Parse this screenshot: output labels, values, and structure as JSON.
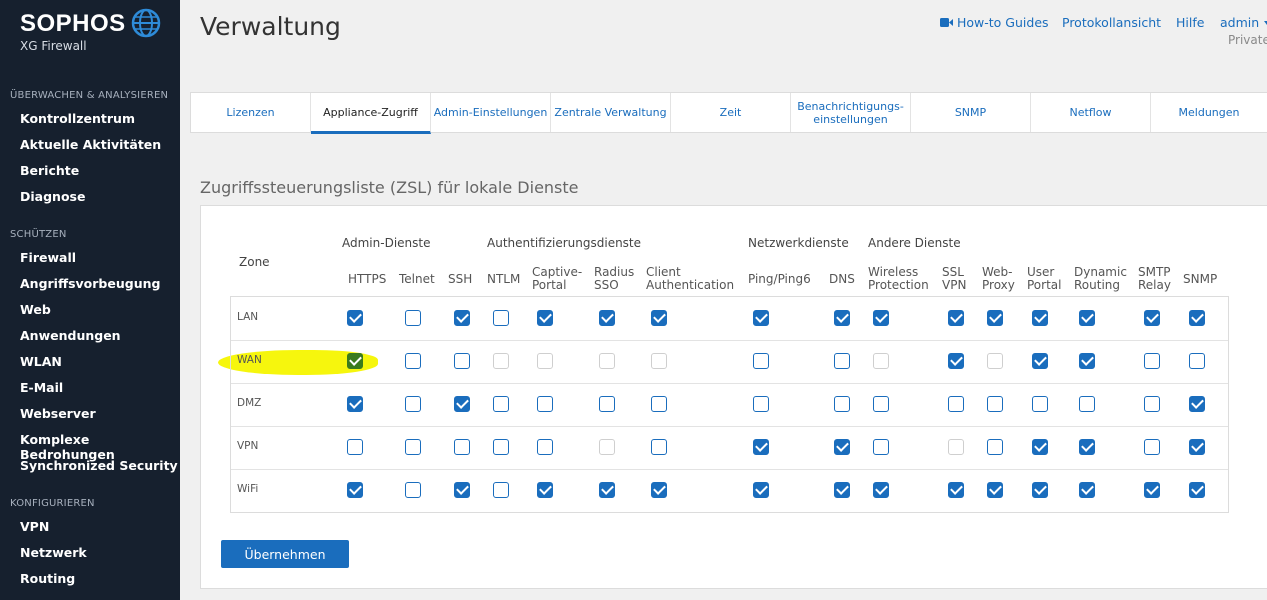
{
  "sidebar": {
    "brand": "SOPHOS",
    "product": "XG Firewall",
    "sections": [
      {
        "title": "ÜBERWACHEN & ANALYSIEREN",
        "items": [
          "Kontrollzentrum",
          "Aktuelle Aktivitäten",
          "Berichte",
          "Diagnose"
        ]
      },
      {
        "title": "SCHÜTZEN",
        "items": [
          "Firewall",
          "Angriffsvorbeugung",
          "Web",
          "Anwendungen",
          "WLAN",
          "E-Mail",
          "Webserver",
          "Komplexe Bedrohungen",
          "Synchronized Security"
        ]
      },
      {
        "title": "KONFIGURIEREN",
        "items": [
          "VPN",
          "Netzwerk",
          "Routing"
        ]
      }
    ]
  },
  "header": {
    "title": "Verwaltung",
    "links": [
      "How-to Guides",
      "Protokollansicht",
      "Hilfe",
      "admin"
    ],
    "subtitle": "Private"
  },
  "tabs": [
    "Lizenzen",
    "Appliance-Zugriff",
    "Admin-Einstellungen",
    "Zentrale Verwaltung",
    "Zeit",
    "Benachrichtigungs-\neinstellungen",
    "SNMP",
    "Netflow",
    "Meldungen"
  ],
  "active_tab": 1,
  "section_title": "Zugriffssteuerungsliste (ZSL) für lokale Dienste",
  "table": {
    "zone_header": "Zone",
    "groups": [
      "Admin-Dienste",
      "Authentifizierungsdienste",
      "Netzwerkdienste",
      "Andere Dienste"
    ],
    "columns": [
      "HTTPS",
      "Telnet",
      "SSH",
      "NTLM",
      "Captive-\nPortal",
      "Radius\nSSO",
      "Client\nAuthentication",
      "Ping/Ping6",
      "DNS",
      "Wireless\nProtection",
      "SSL\nVPN",
      "Web-\nProxy",
      "User\nPortal",
      "Dynamic\nRouting",
      "SMTP\nRelay",
      "SNMP"
    ],
    "zones": [
      "LAN",
      "WAN",
      "DMZ",
      "VPN",
      "WiFi"
    ],
    "states": [
      [
        "on",
        "off",
        "on",
        "off",
        "on",
        "on",
        "on",
        "on",
        "on",
        "on",
        "on",
        "on",
        "on",
        "on",
        "on",
        "on"
      ],
      [
        "on",
        "off",
        "off",
        "dis",
        "dis",
        "dis",
        "dis",
        "off",
        "off",
        "dis",
        "on",
        "dis",
        "on",
        "on",
        "off",
        "off"
      ],
      [
        "on",
        "off",
        "on",
        "off",
        "off",
        "off",
        "off",
        "off",
        "off",
        "off",
        "off",
        "off",
        "off",
        "off",
        "off",
        "on"
      ],
      [
        "off",
        "off",
        "off",
        "off",
        "off",
        "dis",
        "off",
        "on",
        "on",
        "off",
        "dis",
        "off",
        "on",
        "on",
        "off",
        "on"
      ],
      [
        "on",
        "off",
        "on",
        "off",
        "on",
        "on",
        "on",
        "on",
        "on",
        "on",
        "on",
        "on",
        "on",
        "on",
        "on",
        "on"
      ]
    ]
  },
  "apply_label": "Übernehmen",
  "colors": {
    "accent": "#1a6dbd",
    "sidebar": "#16202e",
    "highlight": "#f5f500"
  }
}
